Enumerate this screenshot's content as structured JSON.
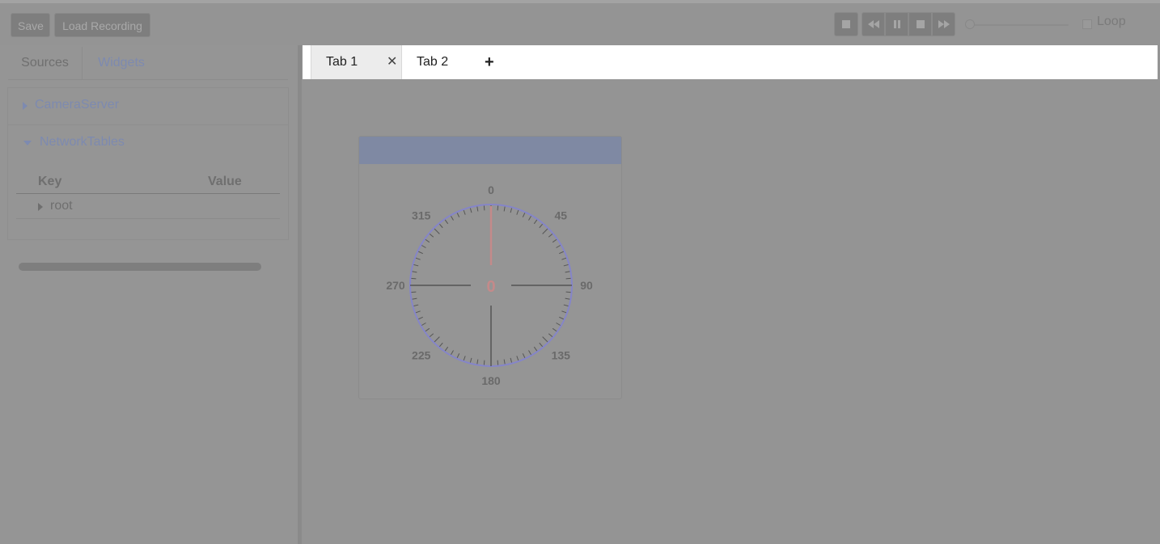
{
  "toolbar": {
    "save_label": "Save",
    "load_recording_label": "Load Recording",
    "loop_label": "Loop",
    "loop_checked": false,
    "playback_progress": 0
  },
  "sidebar": {
    "tabs": [
      {
        "label": "Sources",
        "active": true
      },
      {
        "label": "Widgets",
        "active": false
      }
    ],
    "sources": [
      {
        "label": "CameraServer",
        "expanded": false
      },
      {
        "label": "NetworkTables",
        "expanded": true
      }
    ],
    "networktables": {
      "columns": [
        "Key",
        "Value"
      ],
      "rows": [
        {
          "key": "root",
          "value": ""
        }
      ]
    }
  },
  "tabs": {
    "items": [
      {
        "label": "Tab 1",
        "active": true
      },
      {
        "label": "Tab 2",
        "active": false
      }
    ],
    "close_glyph": "✕",
    "add_glyph": "+"
  },
  "gyro": {
    "title": "",
    "value": 0,
    "value_label": "0",
    "degree_labels": [
      "0",
      "45",
      "90",
      "135",
      "180",
      "225",
      "270",
      "315"
    ],
    "colors": {
      "dial": "#8585c9",
      "needle": "#c48a8a",
      "crosshair": "#555555",
      "labels": "#6a6a6a"
    }
  }
}
